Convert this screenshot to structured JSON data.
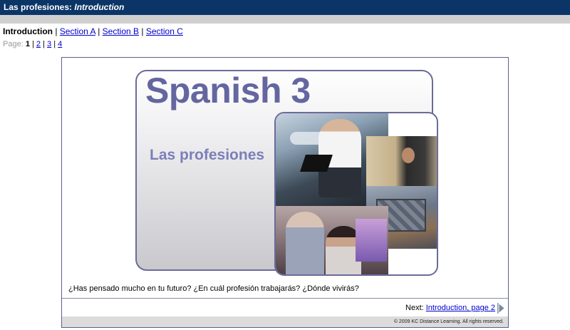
{
  "header": {
    "title": "Las profesiones: ",
    "subtitle": "Introduction"
  },
  "nav": {
    "current": "Introduction",
    "separator": "|",
    "links": [
      "Section A",
      "Section B",
      "Section C"
    ]
  },
  "pages": {
    "label": "Page:",
    "current": "1",
    "links": [
      "2",
      "3",
      "4"
    ],
    "separator": "|"
  },
  "banner": {
    "title": "Spanish 3",
    "subtitle": "Las profesiones"
  },
  "question": "¿Has pensado mucho en tu futuro? ¿En cuál profesión trabajarás?  ¿Dónde vivirás?",
  "next": {
    "label": "Next: ",
    "link": "Introduction, page 2"
  },
  "footer": {
    "copyright": "© 2009 KC Distance Learning. All rights reserved."
  },
  "colors": {
    "header_bg": "#0b3566",
    "link": "#0000cc",
    "accent": "#6466a0"
  }
}
